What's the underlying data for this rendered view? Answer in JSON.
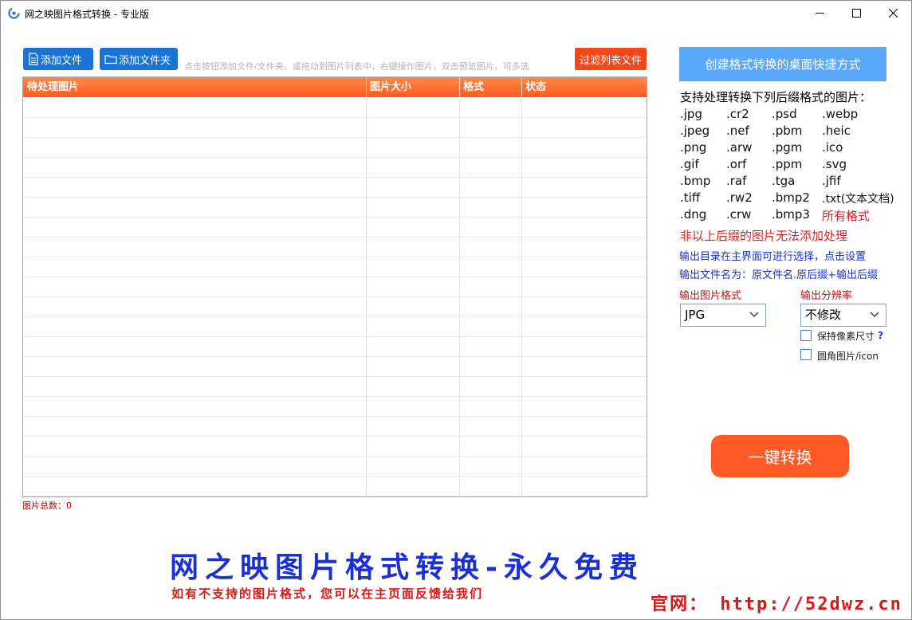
{
  "window": {
    "title": "网之映图片格式转换 - 专业版"
  },
  "toolbar": {
    "add_file_label": "添加文件",
    "add_folder_label": "添加文件夹",
    "hint": "点击按钮添加文件/文件夹，或拖动到图片列表中，右键操作图片，双击预览图片，可多选",
    "filter_label": "过滤列表文件"
  },
  "list": {
    "columns": [
      "待处理图片",
      "图片大小",
      "格式",
      "状态"
    ],
    "rows": []
  },
  "status": {
    "total": "图片总数：0"
  },
  "panel": {
    "shortcut_label": "创建格式转换的桌面快捷方式",
    "support_title": "支持处理转换下列后缀格式的图片：",
    "formats": [
      [
        ".jpg",
        ".cr2",
        ".psd",
        ".webp"
      ],
      [
        ".jpeg",
        ".nef",
        ".pbm",
        ".heic"
      ],
      [
        ".png",
        ".arw",
        ".pgm",
        ".ico"
      ],
      [
        ".gif",
        ".orf",
        ".ppm",
        ".svg"
      ],
      [
        ".bmp",
        ".raf",
        ".tga",
        ".jfif"
      ],
      [
        ".tiff",
        ".rw2",
        ".bmp2",
        ".txt(文本文档)"
      ],
      [
        ".dng",
        ".crw",
        ".bmp3"
      ]
    ],
    "all_formats": "所有格式",
    "warning": "非以上后缀的图片无法添加处理",
    "note_output_dir": "输出目录在主界面可进行选择，点击设置",
    "note_output_name": "输出文件名为：原文件名.原后缀+输出后缀",
    "output_format_label": "输出图片格式",
    "output_format_value": "JPG",
    "resolution_label": "输出分辨率",
    "resolution_value": "不修改",
    "keep_pixel_label": "保持像素尺寸",
    "help_mark": "?",
    "round_icon_label": "圆角图片/icon",
    "keep_pixel_checked": false,
    "round_icon_checked": false,
    "convert_label": "一键转换"
  },
  "banner": {
    "title": "网之映图片格式转换-永久免费",
    "subtitle": "如有不支持的图片格式，您可以在主页面反馈给我们",
    "site": "官网：  http://52dwz.cn"
  },
  "colors": {
    "accent_blue": "#1a73d6",
    "header_orange": "#ff5a1f",
    "convert_orange": "#ff5a25",
    "shortcut_blue": "#5ba9ff",
    "warn_red": "#e02020",
    "note_blue": "#1a2fd6"
  }
}
